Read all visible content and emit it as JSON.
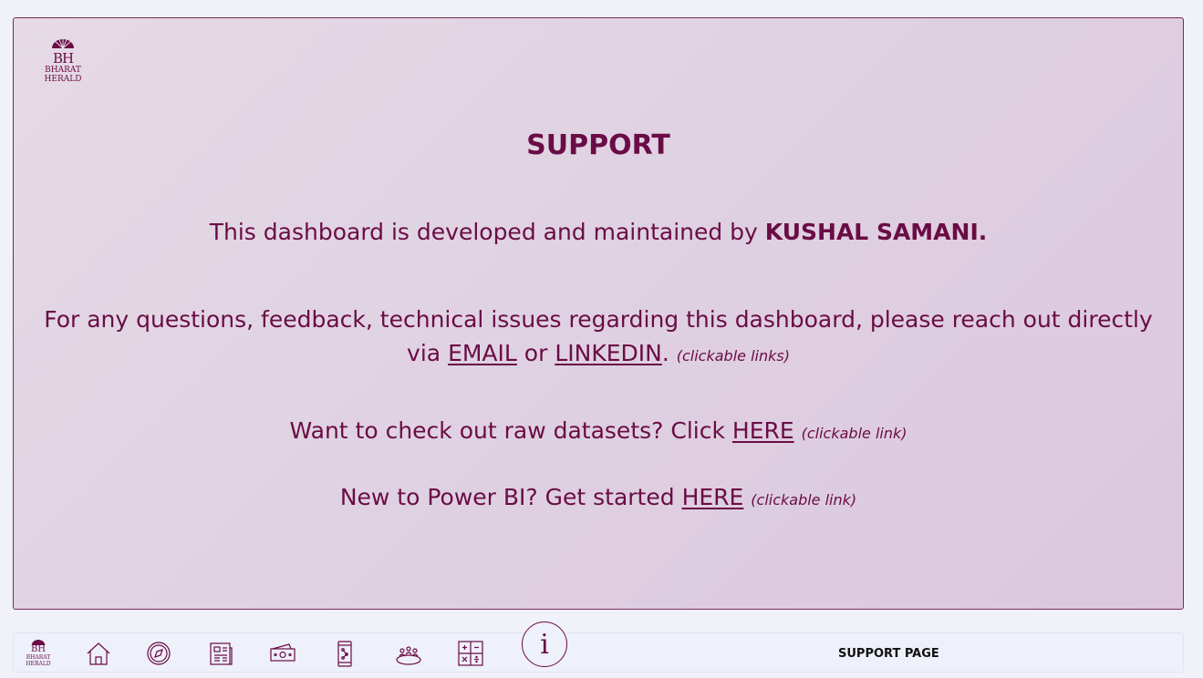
{
  "brand": {
    "mark": "BH",
    "line1": "BHARAT",
    "line2": "HERALD"
  },
  "title": "SUPPORT",
  "developer": {
    "prefix": "This dashboard is developed and maintained by ",
    "name": "KUSHAL SAMANI."
  },
  "contact": {
    "text_line1": "For any questions, feedback, technical issues regarding this dashboard, please reach out directly",
    "text_via": "via ",
    "email_link": "EMAIL",
    "or": " or ",
    "linkedin_link": "LINKEDIN",
    "period": ".",
    "note": "(clickable links)"
  },
  "datasets": {
    "prefix": "Want to check out raw datasets? Click ",
    "link": "HERE",
    "note": "(clickable link)"
  },
  "powerbi": {
    "prefix": "New to Power BI? Get started ",
    "link": "HERE",
    "note": "(clickable link)"
  },
  "nav": {
    "icons": [
      "logo",
      "home-icon",
      "compass-icon",
      "newspaper-icon",
      "money-icon",
      "mobile-icon",
      "audience-icon",
      "calculator-icon",
      "info-icon"
    ],
    "info_glyph": "i",
    "page_label": "SUPPORT PAGE"
  },
  "colors": {
    "accent": "#6a0c45",
    "panel": "#e2d6e3",
    "background": "#f0f1f9"
  }
}
